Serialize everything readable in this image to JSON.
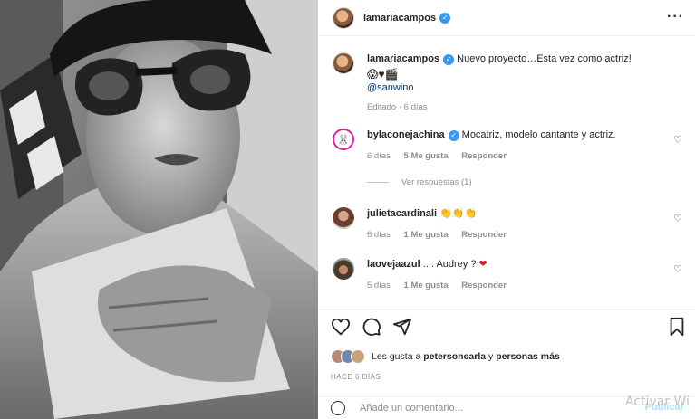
{
  "post": {
    "username": "lamariacampos",
    "caption_text": "Nuevo proyecto…Esta vez como actriz!",
    "caption_emojis": "😱♥🎬",
    "caption_mention": "@sanwino",
    "edited": "Editado · 6 días"
  },
  "comments": [
    {
      "username": "bylaconejachina",
      "text": "Mocatriz, modelo cantante y actriz.",
      "time": "6 días",
      "likes": "5 Me gusta",
      "reply": "Responder"
    },
    {
      "username": "julietacardinali",
      "text": "👏👏👏",
      "time": "6 días",
      "likes": "1 Me gusta",
      "reply": "Responder"
    },
    {
      "username": "laovejaazul",
      "text": ".... Audrey ?",
      "emoji": "❤",
      "time": "5 días",
      "likes": "1 Me gusta",
      "reply": "Responder"
    }
  ],
  "view_replies": "Ver respuestas (1)",
  "likes_summary": {
    "prefix": "Les gusta a",
    "user": "petersoncarla",
    "joiner": "y",
    "rest": "personas más"
  },
  "date": "HACE 6 DÍAS",
  "comment_input": {
    "placeholder": "Añade un comentario..."
  },
  "publish_label": "Publicar",
  "watermark": "Activar Wi",
  "icons": {
    "more": "more-icon",
    "heart": "heart-icon",
    "comment": "comment-icon",
    "share": "share-icon",
    "save": "save-icon",
    "emoji": "emoji-icon"
  },
  "colors": {
    "verified": "#3897f0",
    "link": "#00376b",
    "muted": "#8e8e8e"
  }
}
